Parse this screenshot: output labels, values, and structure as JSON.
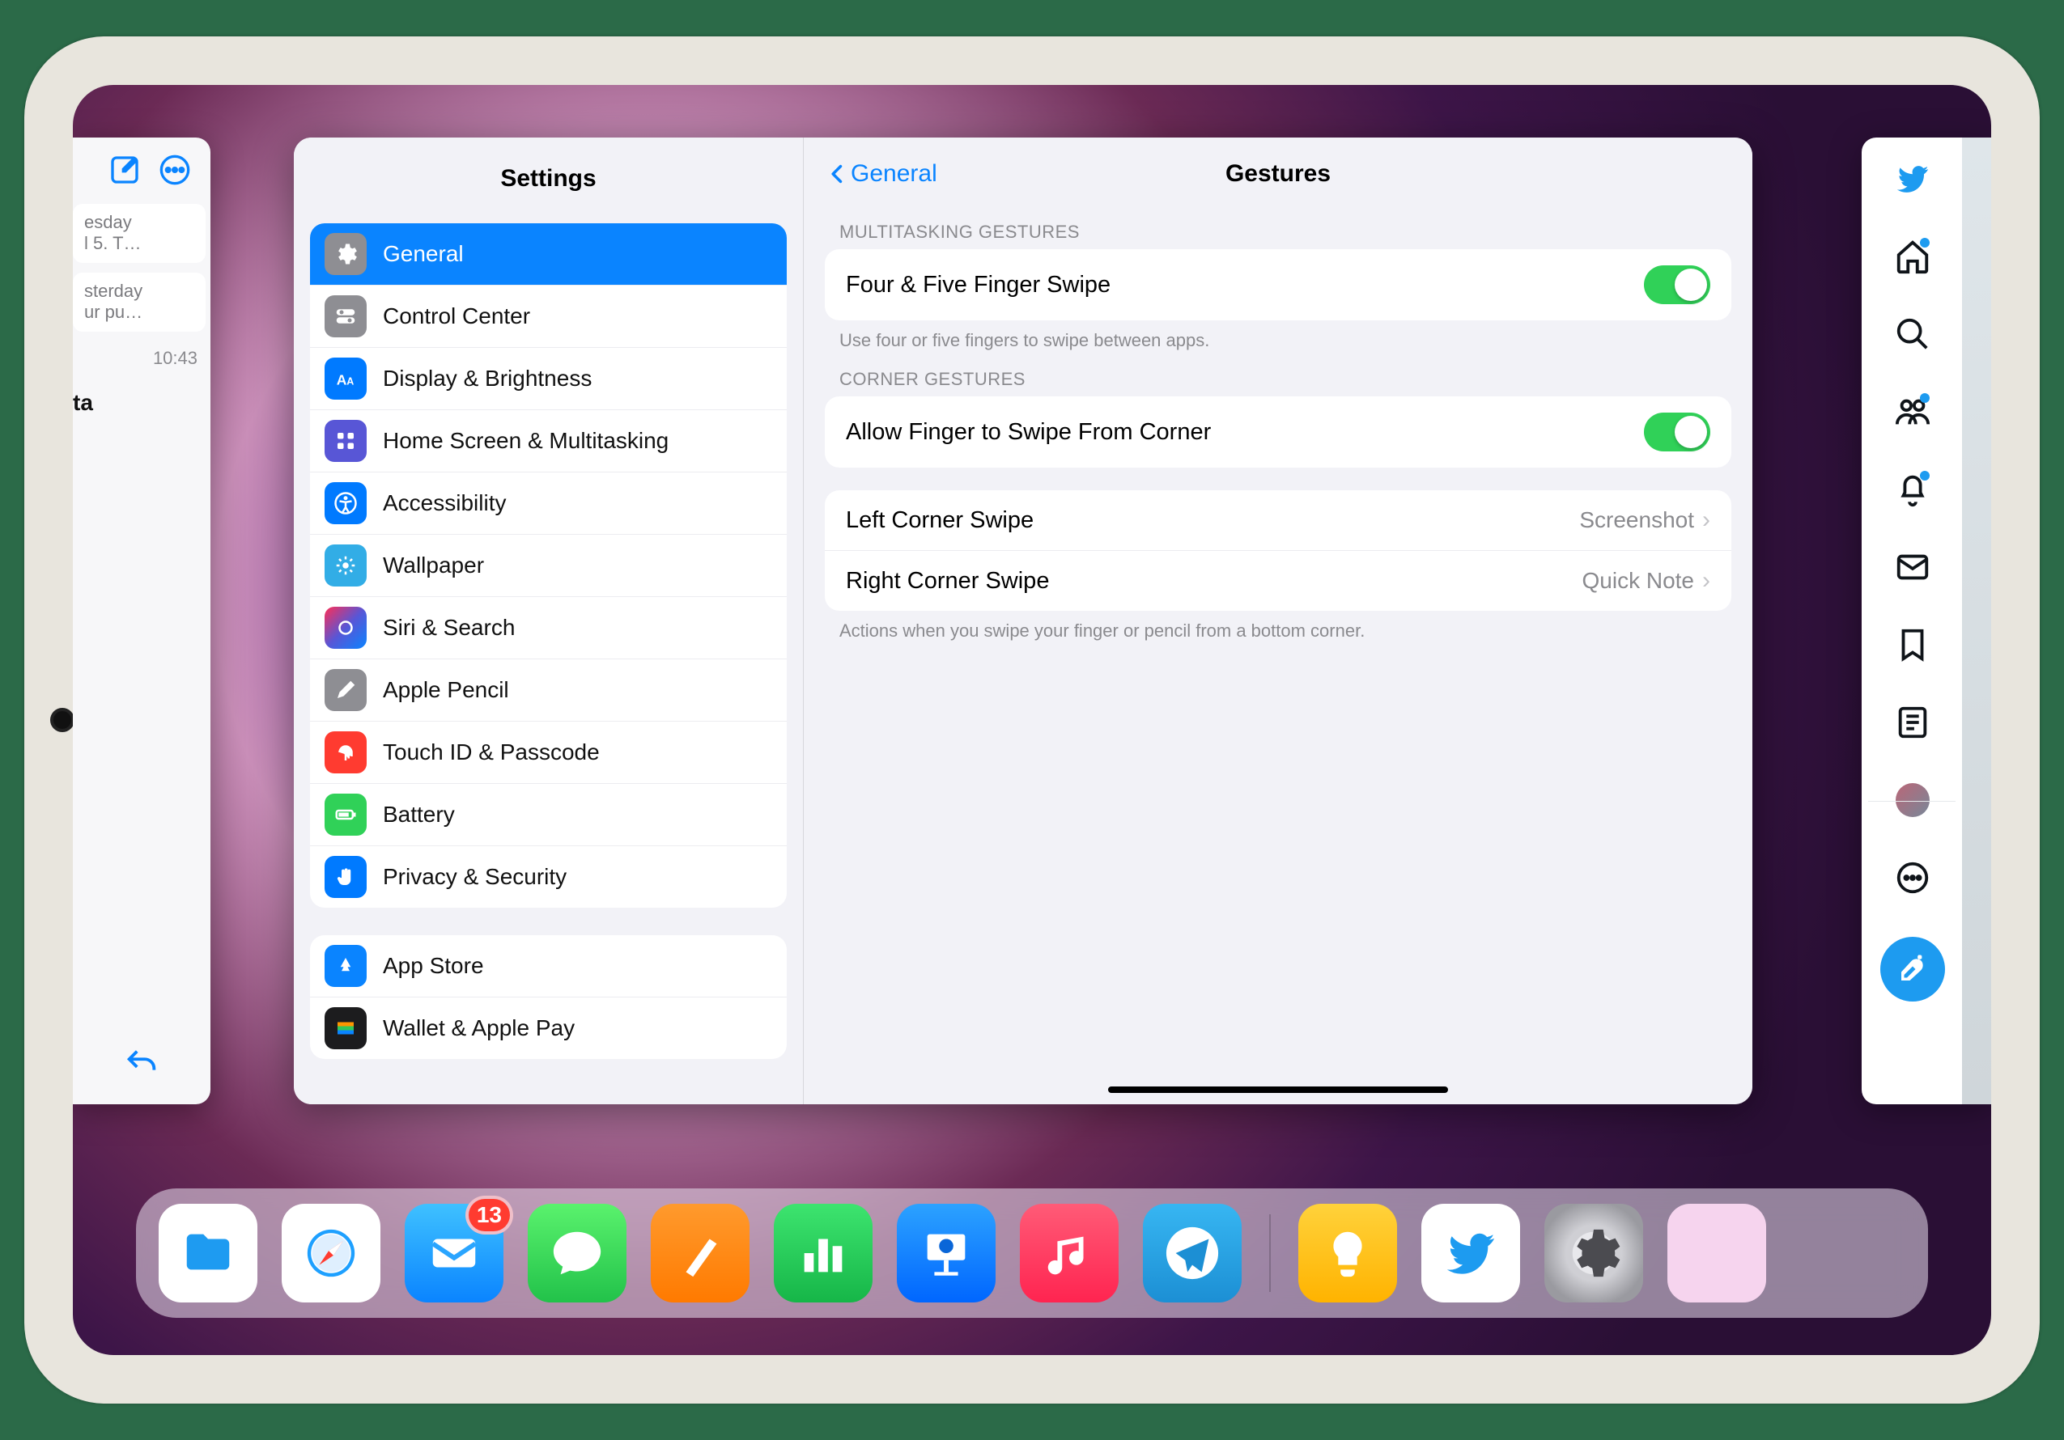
{
  "left_card": {
    "snippet1_line1": "esday",
    "snippet1_line2": "l 5. T…",
    "snippet2_line1": "sterday",
    "snippet2_line2": "ur pu…",
    "time": "10:43",
    "label": "ta"
  },
  "sidebar": {
    "title": "Settings",
    "group1": [
      {
        "label": "General",
        "icon": "gear",
        "color": "grey",
        "selected": true
      },
      {
        "label": "Control Center",
        "icon": "toggles",
        "color": "grey"
      },
      {
        "label": "Display & Brightness",
        "icon": "aa",
        "color": "blue"
      },
      {
        "label": "Home Screen & Multitasking",
        "icon": "grid",
        "color": "indigo"
      },
      {
        "label": "Accessibility",
        "icon": "access",
        "color": "blue"
      },
      {
        "label": "Wallpaper",
        "icon": "flower",
        "color": "cyan"
      },
      {
        "label": "Siri & Search",
        "icon": "siri",
        "color": "img"
      },
      {
        "label": "Apple Pencil",
        "icon": "pencil",
        "color": "grey"
      },
      {
        "label": "Touch ID & Passcode",
        "icon": "finger",
        "color": "red"
      },
      {
        "label": "Battery",
        "icon": "battery",
        "color": "green"
      },
      {
        "label": "Privacy & Security",
        "icon": "hand",
        "color": "blue"
      }
    ],
    "group2": [
      {
        "label": "App Store",
        "icon": "appstore",
        "color": "sky"
      },
      {
        "label": "Wallet & Apple Pay",
        "icon": "wallet",
        "color": "dark"
      }
    ]
  },
  "detail": {
    "back_label": "General",
    "title": "Gestures",
    "section1_header": "MULTITASKING GESTURES",
    "row1_label": "Four & Five Finger Swipe",
    "row1_footer": "Use four or five fingers to swipe between apps.",
    "section2_header": "CORNER GESTURES",
    "row2_label": "Allow Finger to Swipe From Corner",
    "row3_label": "Left Corner Swipe",
    "row3_value": "Screenshot",
    "row4_label": "Right Corner Swipe",
    "row4_value": "Quick Note",
    "section3_footer": "Actions when you swipe your finger or pencil from a bottom corner."
  },
  "dock": {
    "mail_badge": "13"
  }
}
